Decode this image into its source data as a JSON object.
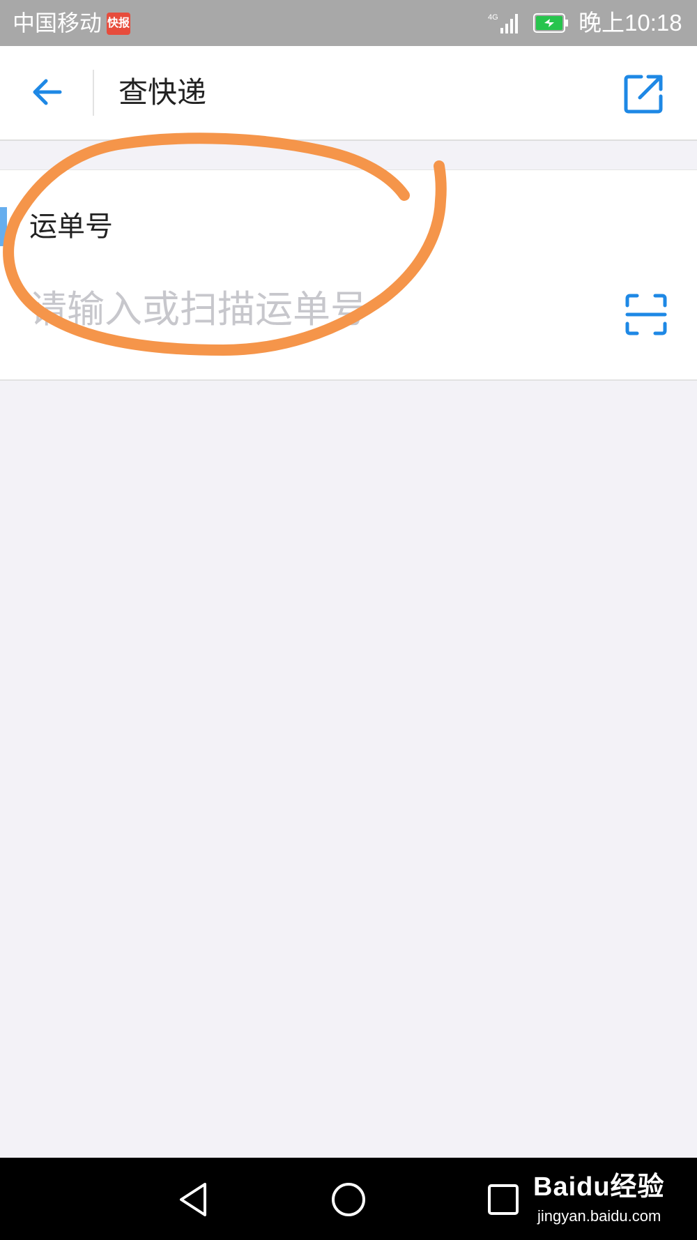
{
  "status_bar": {
    "carrier": "中国移动",
    "badge": "快报",
    "network": "4G",
    "time": "晚上10:18"
  },
  "header": {
    "title": "查快递",
    "back_icon": "arrow-left-icon",
    "share_icon": "external-link-icon"
  },
  "form": {
    "label": "运单号",
    "placeholder": "请输入或扫描运单号",
    "value": "",
    "scan_icon": "scan-icon"
  },
  "annotation": {
    "color": "#f5954a"
  },
  "nav_bar": {
    "back_icon": "triangle-back-icon",
    "home_icon": "circle-home-icon",
    "recent_icon": "square-recent-icon"
  },
  "watermark": {
    "main": "Baidu经验",
    "sub": "jingyan.baidu.com"
  },
  "colors": {
    "accent": "#1e88e5",
    "background": "#f3f2f7",
    "placeholder": "#c7c7cc",
    "status_bar": "#a8a8a8"
  }
}
